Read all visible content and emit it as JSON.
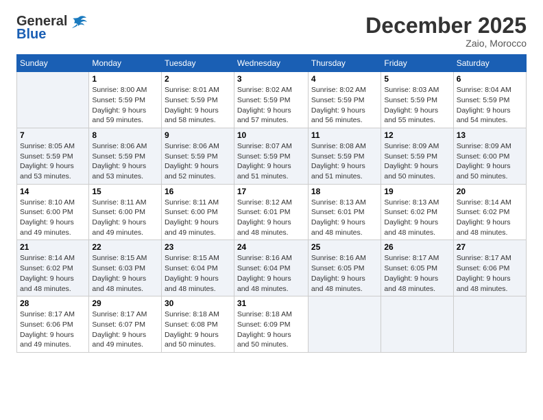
{
  "header": {
    "logo_line1": "General",
    "logo_line2": "Blue",
    "month": "December 2025",
    "location": "Zaio, Morocco"
  },
  "days_of_week": [
    "Sunday",
    "Monday",
    "Tuesday",
    "Wednesday",
    "Thursday",
    "Friday",
    "Saturday"
  ],
  "weeks": [
    [
      {
        "num": "",
        "info": ""
      },
      {
        "num": "1",
        "info": "Sunrise: 8:00 AM\nSunset: 5:59 PM\nDaylight: 9 hours\nand 59 minutes."
      },
      {
        "num": "2",
        "info": "Sunrise: 8:01 AM\nSunset: 5:59 PM\nDaylight: 9 hours\nand 58 minutes."
      },
      {
        "num": "3",
        "info": "Sunrise: 8:02 AM\nSunset: 5:59 PM\nDaylight: 9 hours\nand 57 minutes."
      },
      {
        "num": "4",
        "info": "Sunrise: 8:02 AM\nSunset: 5:59 PM\nDaylight: 9 hours\nand 56 minutes."
      },
      {
        "num": "5",
        "info": "Sunrise: 8:03 AM\nSunset: 5:59 PM\nDaylight: 9 hours\nand 55 minutes."
      },
      {
        "num": "6",
        "info": "Sunrise: 8:04 AM\nSunset: 5:59 PM\nDaylight: 9 hours\nand 54 minutes."
      }
    ],
    [
      {
        "num": "7",
        "info": "Sunrise: 8:05 AM\nSunset: 5:59 PM\nDaylight: 9 hours\nand 53 minutes."
      },
      {
        "num": "8",
        "info": "Sunrise: 8:06 AM\nSunset: 5:59 PM\nDaylight: 9 hours\nand 53 minutes."
      },
      {
        "num": "9",
        "info": "Sunrise: 8:06 AM\nSunset: 5:59 PM\nDaylight: 9 hours\nand 52 minutes."
      },
      {
        "num": "10",
        "info": "Sunrise: 8:07 AM\nSunset: 5:59 PM\nDaylight: 9 hours\nand 51 minutes."
      },
      {
        "num": "11",
        "info": "Sunrise: 8:08 AM\nSunset: 5:59 PM\nDaylight: 9 hours\nand 51 minutes."
      },
      {
        "num": "12",
        "info": "Sunrise: 8:09 AM\nSunset: 5:59 PM\nDaylight: 9 hours\nand 50 minutes."
      },
      {
        "num": "13",
        "info": "Sunrise: 8:09 AM\nSunset: 6:00 PM\nDaylight: 9 hours\nand 50 minutes."
      }
    ],
    [
      {
        "num": "14",
        "info": "Sunrise: 8:10 AM\nSunset: 6:00 PM\nDaylight: 9 hours\nand 49 minutes."
      },
      {
        "num": "15",
        "info": "Sunrise: 8:11 AM\nSunset: 6:00 PM\nDaylight: 9 hours\nand 49 minutes."
      },
      {
        "num": "16",
        "info": "Sunrise: 8:11 AM\nSunset: 6:00 PM\nDaylight: 9 hours\nand 49 minutes."
      },
      {
        "num": "17",
        "info": "Sunrise: 8:12 AM\nSunset: 6:01 PM\nDaylight: 9 hours\nand 48 minutes."
      },
      {
        "num": "18",
        "info": "Sunrise: 8:13 AM\nSunset: 6:01 PM\nDaylight: 9 hours\nand 48 minutes."
      },
      {
        "num": "19",
        "info": "Sunrise: 8:13 AM\nSunset: 6:02 PM\nDaylight: 9 hours\nand 48 minutes."
      },
      {
        "num": "20",
        "info": "Sunrise: 8:14 AM\nSunset: 6:02 PM\nDaylight: 9 hours\nand 48 minutes."
      }
    ],
    [
      {
        "num": "21",
        "info": "Sunrise: 8:14 AM\nSunset: 6:02 PM\nDaylight: 9 hours\nand 48 minutes."
      },
      {
        "num": "22",
        "info": "Sunrise: 8:15 AM\nSunset: 6:03 PM\nDaylight: 9 hours\nand 48 minutes."
      },
      {
        "num": "23",
        "info": "Sunrise: 8:15 AM\nSunset: 6:04 PM\nDaylight: 9 hours\nand 48 minutes."
      },
      {
        "num": "24",
        "info": "Sunrise: 8:16 AM\nSunset: 6:04 PM\nDaylight: 9 hours\nand 48 minutes."
      },
      {
        "num": "25",
        "info": "Sunrise: 8:16 AM\nSunset: 6:05 PM\nDaylight: 9 hours\nand 48 minutes."
      },
      {
        "num": "26",
        "info": "Sunrise: 8:17 AM\nSunset: 6:05 PM\nDaylight: 9 hours\nand 48 minutes."
      },
      {
        "num": "27",
        "info": "Sunrise: 8:17 AM\nSunset: 6:06 PM\nDaylight: 9 hours\nand 48 minutes."
      }
    ],
    [
      {
        "num": "28",
        "info": "Sunrise: 8:17 AM\nSunset: 6:06 PM\nDaylight: 9 hours\nand 49 minutes."
      },
      {
        "num": "29",
        "info": "Sunrise: 8:17 AM\nSunset: 6:07 PM\nDaylight: 9 hours\nand 49 minutes."
      },
      {
        "num": "30",
        "info": "Sunrise: 8:18 AM\nSunset: 6:08 PM\nDaylight: 9 hours\nand 50 minutes."
      },
      {
        "num": "31",
        "info": "Sunrise: 8:18 AM\nSunset: 6:09 PM\nDaylight: 9 hours\nand 50 minutes."
      },
      {
        "num": "",
        "info": ""
      },
      {
        "num": "",
        "info": ""
      },
      {
        "num": "",
        "info": ""
      }
    ]
  ]
}
